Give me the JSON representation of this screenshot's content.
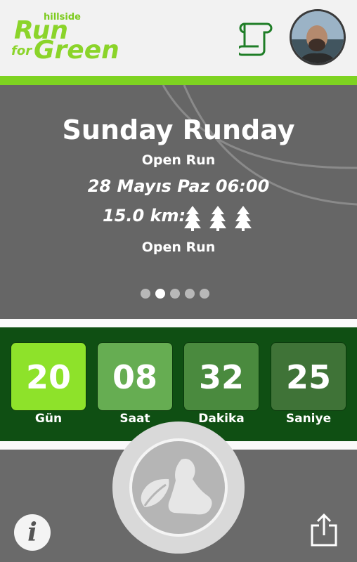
{
  "header": {
    "logo": {
      "top": "hillside",
      "line1": "Run",
      "line2_small": "for",
      "line2": "Green"
    },
    "scroll_icon": "scroll-icon",
    "avatar": "profile-avatar"
  },
  "colors": {
    "accent_green": "#7ed321",
    "dark_green": "#0f4f13",
    "banner_gray": "#666666"
  },
  "event": {
    "title": "Sunday Runday",
    "type": "Open Run",
    "date": "28 Mayıs Paz 06:00",
    "distance": "15.0 km:",
    "difficulty_icon": "tree-icon",
    "difficulty_count": 3,
    "category": "Open Run"
  },
  "carousel": {
    "total": 5,
    "active_index": 1
  },
  "countdown": [
    {
      "value": "20",
      "label": "Gün",
      "color": "#8ee22a"
    },
    {
      "value": "08",
      "label": "Saat",
      "color": "#66ad52"
    },
    {
      "value": "32",
      "label": "Dakika",
      "color": "#4a8a3e"
    },
    {
      "value": "25",
      "label": "Saniye",
      "color": "#3f7337"
    }
  ],
  "bottom": {
    "info_label": "i",
    "run_icon": "run-shoe-icon",
    "share_icon": "share-icon"
  }
}
